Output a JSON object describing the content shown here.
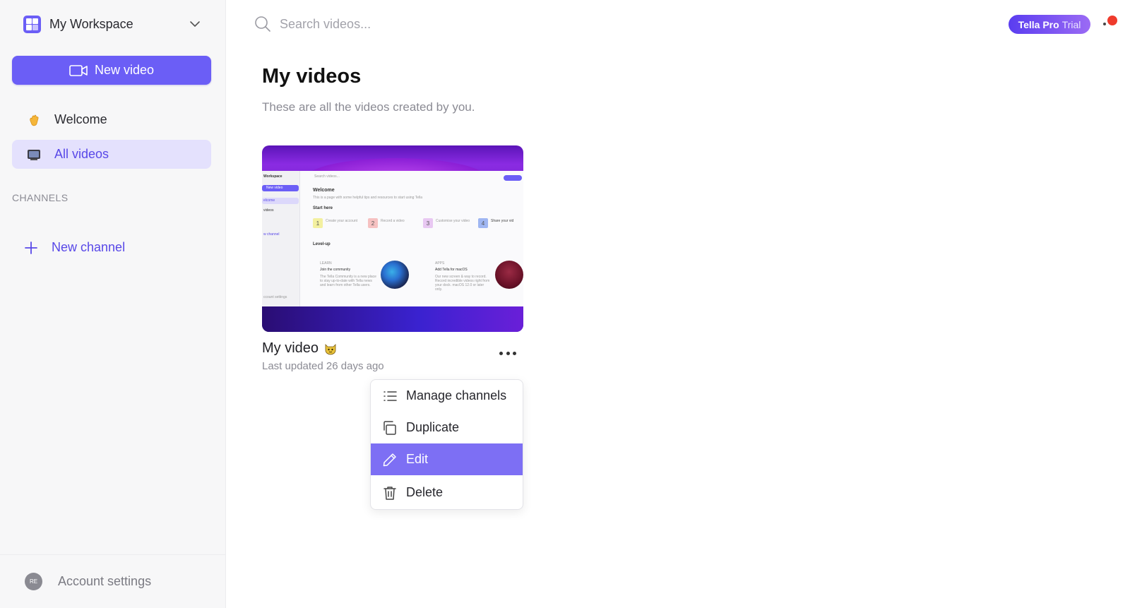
{
  "sidebar": {
    "workspace_name": "My Workspace",
    "new_video_label": "New video",
    "nav": [
      {
        "label": "Welcome",
        "icon": "waving-hand-emoji"
      },
      {
        "label": "All videos",
        "icon": "television-emoji",
        "active": true
      }
    ],
    "channels_label": "CHANNELS",
    "new_channel_label": "New channel",
    "account": {
      "initials": "RE",
      "label": "Account settings"
    }
  },
  "header": {
    "search_placeholder": "Search videos...",
    "trial_badge": {
      "strong": "Tella Pro",
      "light": "Trial"
    }
  },
  "main": {
    "title": "My videos",
    "subtitle": "These are all the videos created by you."
  },
  "video": {
    "title": "My video",
    "title_emoji": "cat-face-emoji",
    "updated": "Last updated 26 days ago",
    "thumbnail": {
      "workspace": "Workspace",
      "search": "Search videos...",
      "new_video": "New video",
      "nav_welcome": "elcome",
      "nav_all": "videos",
      "new_channel": "w channel",
      "account": "ccount settings",
      "welcome": "Welcome",
      "welcome_desc": "This is a page with some helpful tips and resources to start using Tella",
      "start_here": "Start here",
      "steps": [
        {
          "n": "1",
          "label": "Create your account"
        },
        {
          "n": "2",
          "label": "Record a video"
        },
        {
          "n": "3",
          "label": "Customise your video"
        },
        {
          "n": "4",
          "label": "Share your vid"
        }
      ],
      "level_up": "Level-up",
      "card1_kicker": "LEARN",
      "card1_title": "Join the community",
      "card1_desc": "The Tella Community is a new place to stay up-to-date with Tella news and learn from other Tella users.",
      "card2_kicker": "APPS",
      "card2_title": "Add Tella for macOS",
      "card2_desc": "Our new screen & way to record. Record incredible videos right from your dock. macOS 12.0 or later only."
    }
  },
  "menu": {
    "items": [
      {
        "label": "Manage channels",
        "icon": "list-icon"
      },
      {
        "label": "Duplicate",
        "icon": "copy-icon"
      },
      {
        "label": "Edit",
        "icon": "pencil-icon",
        "highlighted": true
      },
      {
        "label": "Delete",
        "icon": "trash-icon"
      }
    ]
  },
  "colors": {
    "accent": "#6b5ef6",
    "accent_text": "#5848e8",
    "menu_highlight": "#7d6ff4",
    "notification": "#ef3b2c"
  }
}
